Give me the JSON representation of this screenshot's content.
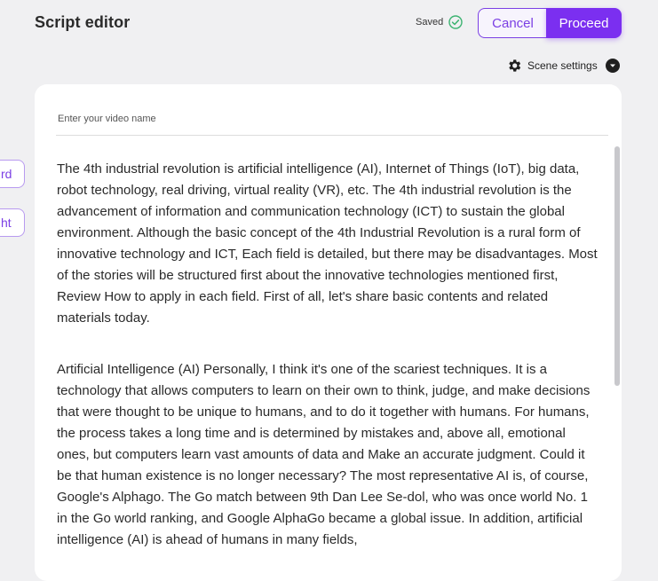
{
  "header": {
    "title": "Script editor",
    "saved_label": "Saved",
    "cancel_label": "Cancel",
    "proceed_label": "Proceed",
    "scene_settings_label": "Scene settings"
  },
  "side_buttons": [
    "rd",
    "ht"
  ],
  "editor": {
    "name_placeholder": "Enter your video name",
    "paragraphs": [
      "The 4th industrial revolution is artificial intelligence (AI), Internet of Things (IoT), big data, robot technology, real driving, virtual reality (VR), etc. The 4th industrial revolution is the advancement of information and communication technology (ICT) to sustain the global environment. Although the basic concept of the 4th Industrial Revolution is a rural form of innovative technology and ICT, Each field is detailed, but there may be disadvantages. Most of the stories will be structured first about the innovative technologies mentioned first, Review How to apply in each field. First of all, let's share basic contents and related materials today.",
      "Artificial Intelligence (AI) Personally, I think it's one of the scariest techniques. It is a technology that allows computers to learn on their own to think, judge, and make decisions that were thought to be unique to humans, and to do it together with humans. For humans, the process takes a long time and is determined by mistakes and, above all, emotional ones, but computers learn vast amounts of data and Make an accurate judgment. Could it be that human existence is no longer necessary? The most representative AI is, of course, Google's Alphago. The Go match between 9th Dan Lee Se-dol, who was once world No. 1 in the Go world ranking, and Google AlphaGo became a global issue. In addition, artificial intelligence (AI) is ahead of humans in many fields,"
    ]
  },
  "colors": {
    "accent": "#7b2ff0",
    "saved_check": "#3cb371",
    "background": "#f0f0f2"
  },
  "icons": {
    "saved": "check-circle-icon",
    "settings": "gear-icon",
    "dropdown": "chevron-down-icon"
  }
}
